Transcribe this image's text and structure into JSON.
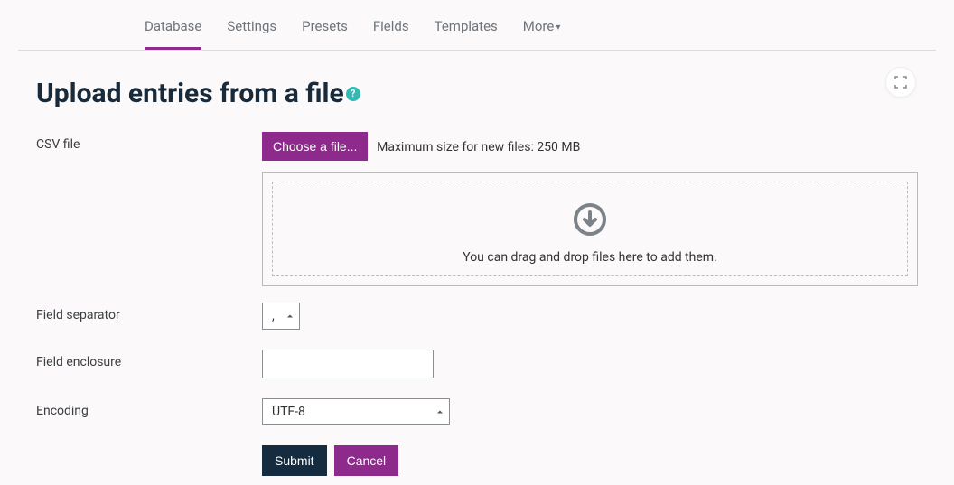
{
  "tabs": {
    "database": "Database",
    "settings": "Settings",
    "presets": "Presets",
    "fields": "Fields",
    "templates": "Templates",
    "more": "More"
  },
  "heading": "Upload entries from a file",
  "help_glyph": "?",
  "labels": {
    "csv_file": "CSV file",
    "field_separator": "Field separator",
    "field_enclosure": "Field enclosure",
    "encoding": "Encoding"
  },
  "file": {
    "choose_btn": "Choose a file...",
    "size_hint": "Maximum size for new files: 250 MB",
    "drop_text": "You can drag and drop files here to add them."
  },
  "values": {
    "separator": ",",
    "enclosure": "",
    "encoding": "UTF-8"
  },
  "buttons": {
    "submit": "Submit",
    "cancel": "Cancel"
  }
}
